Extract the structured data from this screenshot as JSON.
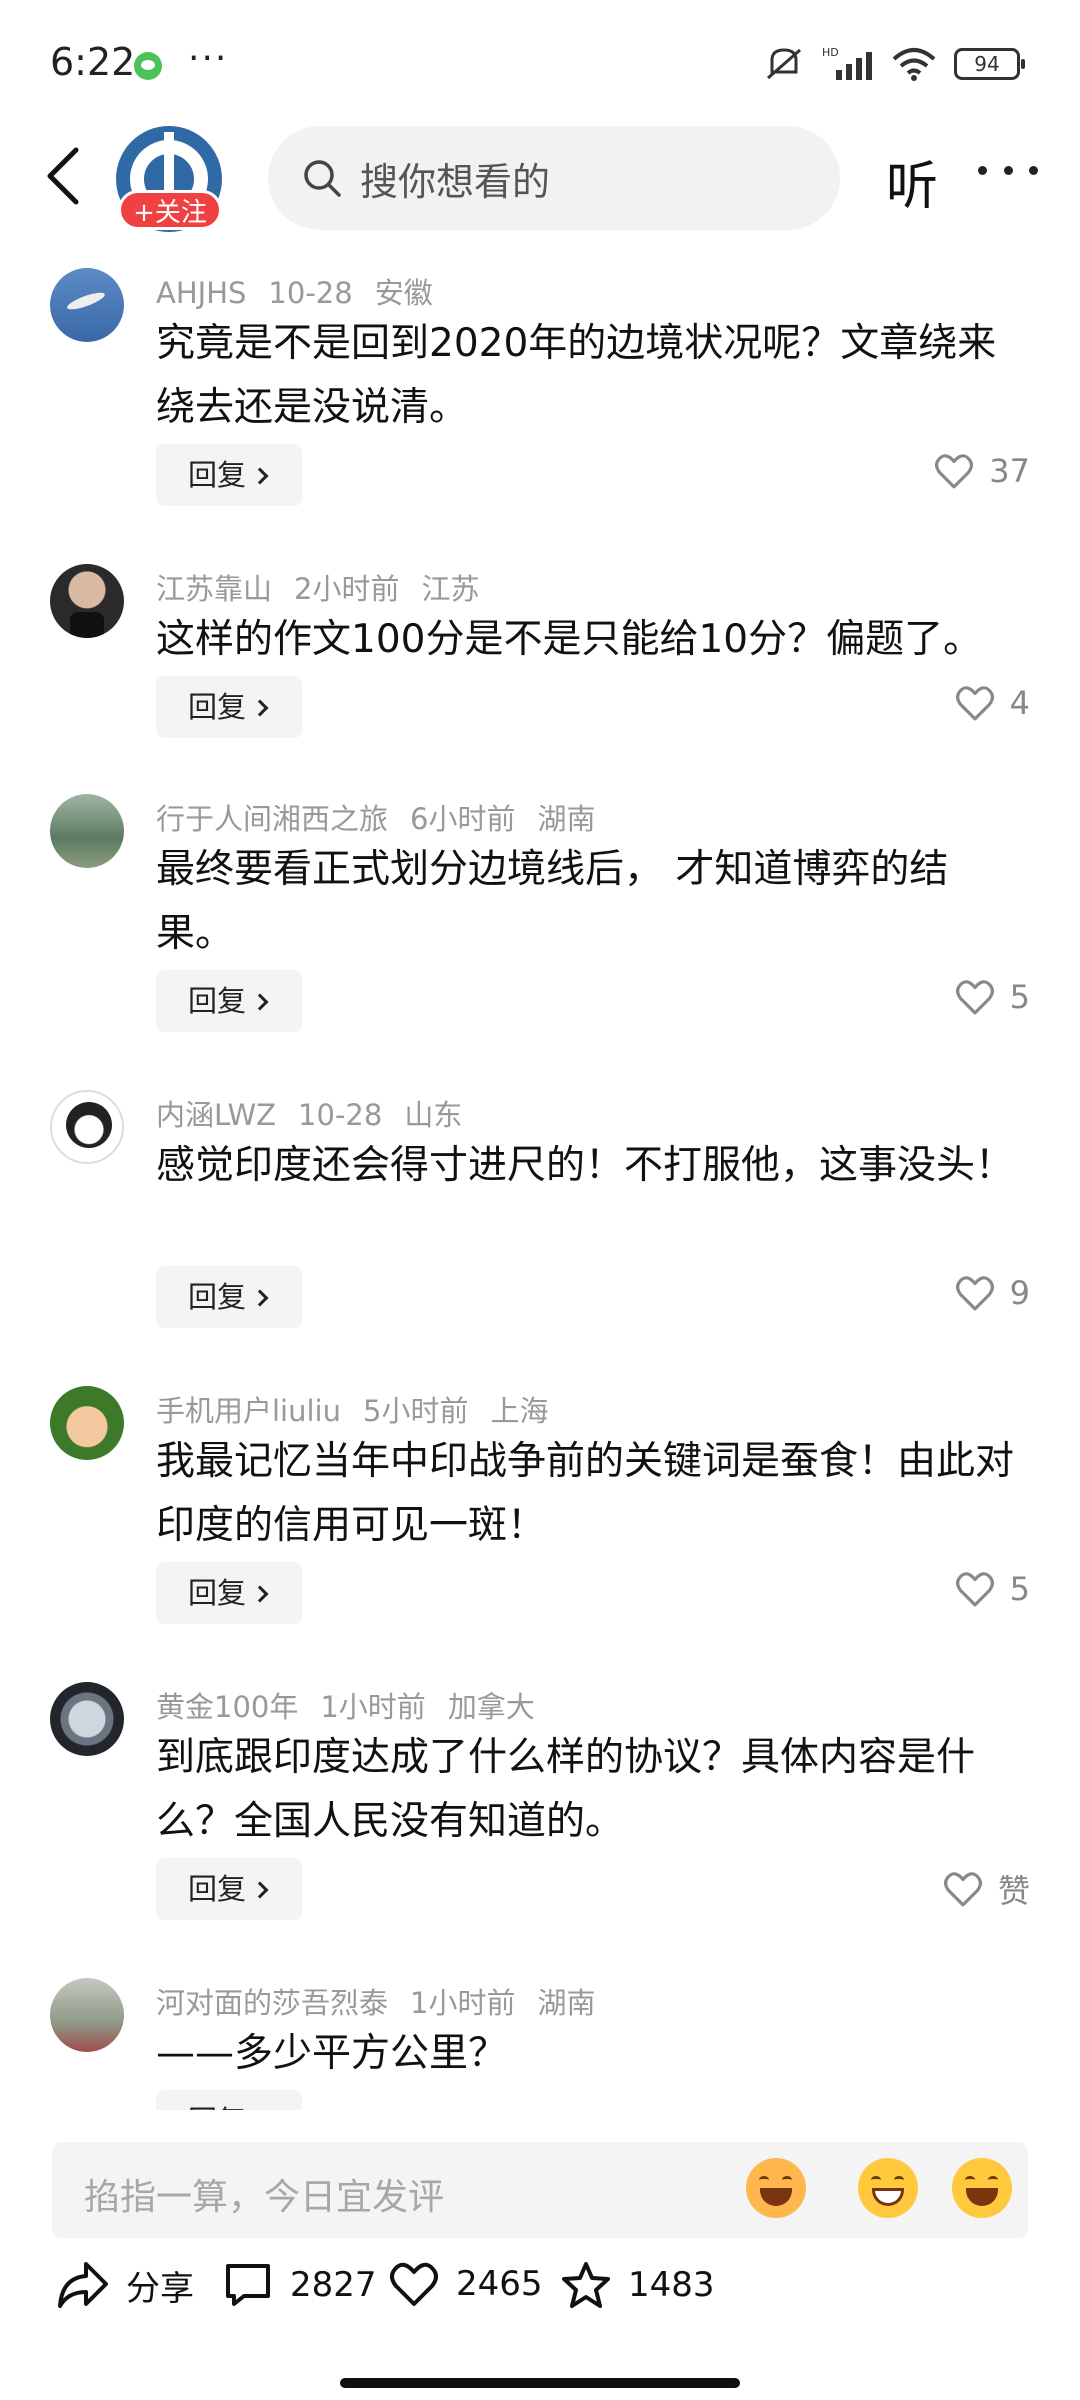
{
  "status_bar": {
    "time": "6:22",
    "battery": "94",
    "more": "···",
    "hd_label": "HD"
  },
  "header": {
    "follow_label": "+关注",
    "search_placeholder": "搜你想看的",
    "listen_label": "听"
  },
  "comments": [
    {
      "user": "AHJHS",
      "time": "10-28",
      "location": "安徽",
      "text": "究竟是不是回到2020年的边境状况呢？文章绕来绕去还是没说清。",
      "likes": "37",
      "avatar": "sky"
    },
    {
      "user": "江苏靠山",
      "time": "2小时前",
      "location": "江苏",
      "text": "这样的作文100分是不是只能给10分？偏题了。",
      "likes": "4",
      "avatar": "man"
    },
    {
      "user": "行于人间湘西之旅",
      "time": "6小时前",
      "location": "湖南",
      "text": "最终要看正式划分边境线后， 才知道博弈的结果。",
      "likes": "5",
      "avatar": "forest"
    },
    {
      "user": "内涵LWZ",
      "time": "10-28",
      "location": "山东",
      "text": "感觉印度还会得寸进尺的！不打服他，这事没头！",
      "likes": "9",
      "avatar": "cartoon"
    },
    {
      "user": "手机用户liuliu",
      "time": "5小时前",
      "location": "上海",
      "text": "我最记忆当年中印战争前的关键词是蚕食！由此对印度的信用可见一斑！",
      "likes": "5",
      "avatar": "soldier"
    },
    {
      "user": "黄金100年",
      "time": "1小时前",
      "location": "加拿大",
      "text": "到底跟印度达成了什么样的协议？具体内容是什么？全国人民没有知道的。",
      "likes": "赞",
      "avatar": "watch"
    },
    {
      "user": "河对面的莎吾烈泰",
      "time": "1小时前",
      "location": "湖南",
      "text": "——多少平方公里？",
      "likes": "",
      "avatar": "street"
    }
  ],
  "reply_label": "回复",
  "bottom": {
    "input_placeholder": "掐指一算，今日宜发评",
    "share_label": "分享",
    "comment_count": "2827",
    "like_count": "2465",
    "favorite_count": "1483"
  },
  "colors": {
    "accent": "#f04142",
    "meta": "#999999",
    "bg_input": "#f4f4f5"
  }
}
